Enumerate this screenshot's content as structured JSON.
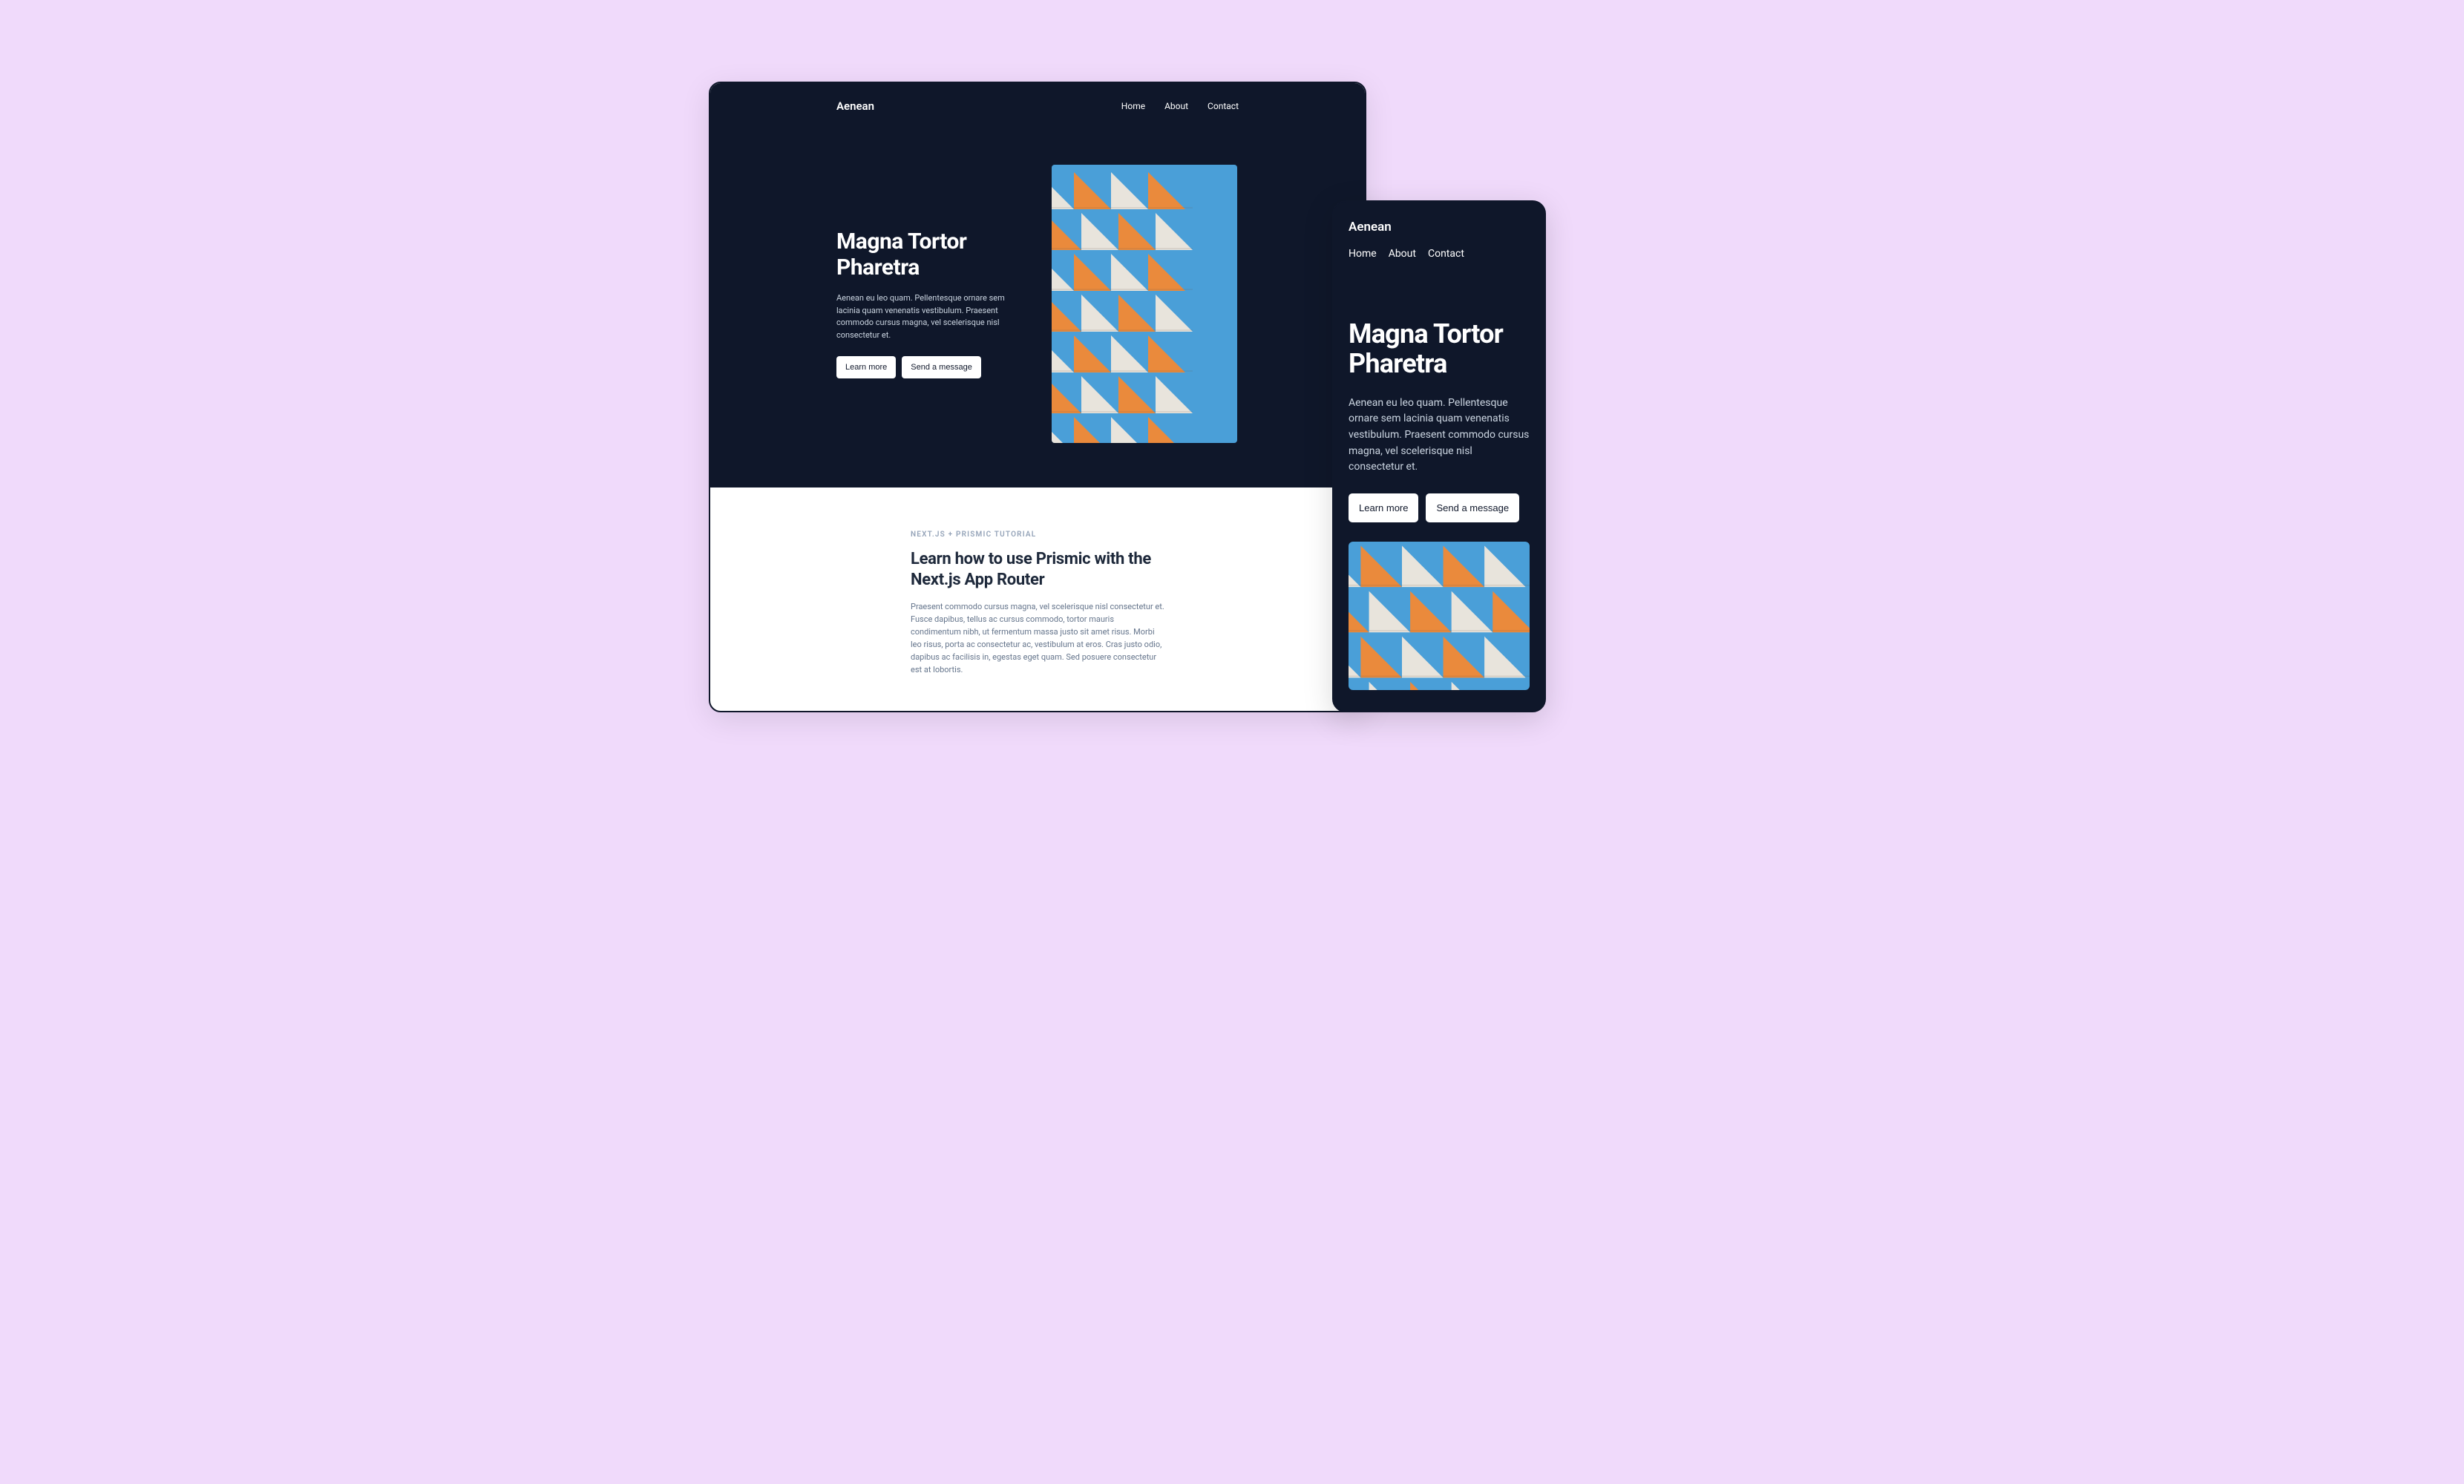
{
  "brand": "Aenean",
  "nav": {
    "items": [
      {
        "label": "Home"
      },
      {
        "label": "About"
      },
      {
        "label": "Contact"
      }
    ]
  },
  "hero": {
    "title": "Magna Tortor Pharetra",
    "description": "Aenean eu leo quam. Pellentesque ornare sem lacinia quam venenatis vestibulum. Praesent commodo cursus magna, vel scelerisque nisl consectetur et.",
    "buttons": {
      "primary": "Learn more",
      "secondary": "Send a message"
    }
  },
  "article": {
    "eyebrow": "NEXT.JS + PRISMIC TUTORIAL",
    "title": "Learn how to use Prismic with the Next.js App Router",
    "body": "Praesent commodo cursus magna, vel scelerisque nisl consectetur et. Fusce dapibus, tellus ac cursus commodo, tortor mauris condimentum nibh, ut fermentum massa justo sit amet risus. Morbi leo risus, porta ac consectetur ac, vestibulum at eros. Cras justo odio, dapibus ac facilisis in, egestas eget quam. Sed posuere consectetur est at lobortis."
  }
}
